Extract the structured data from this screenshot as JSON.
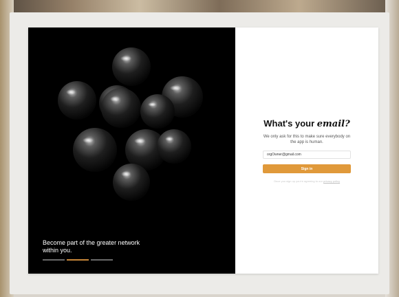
{
  "hero": {
    "tagline": "Become part of the greater network within you.",
    "slides": [
      {
        "active": false
      },
      {
        "active": true
      },
      {
        "active": false
      }
    ]
  },
  "form": {
    "title_prefix": "What's your ",
    "title_emphasis": "email?",
    "subtitle": "We only ask for this to make sure everybody on the app is human.",
    "email_value": "orgOwner@gmail.com",
    "signin_label": "Sign in",
    "terms_text": "Once you sign up you're agreeing to our ",
    "terms_link": "privacy policy",
    "accent_color": "#e0993a"
  }
}
